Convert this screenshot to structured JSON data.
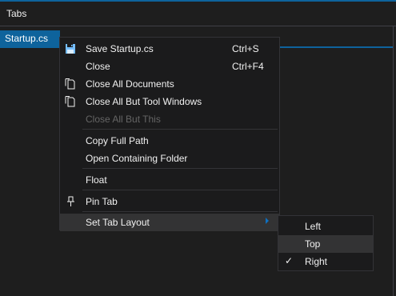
{
  "panel": {
    "title": "Tabs"
  },
  "tab": {
    "label": "Startup.cs"
  },
  "context_menu": {
    "items": [
      {
        "label": "Save Startup.cs",
        "shortcut": "Ctrl+S",
        "icon": "save-icon"
      },
      {
        "label": "Close",
        "shortcut": "Ctrl+F4"
      },
      {
        "label": "Close All Documents",
        "icon": "close-all-documents-icon"
      },
      {
        "label": "Close All But Tool Windows",
        "icon": "close-all-but-tool-windows-icon"
      },
      {
        "label": "Close All But This",
        "disabled": true
      },
      {
        "label": "Copy Full Path"
      },
      {
        "label": "Open Containing Folder"
      },
      {
        "label": "Float"
      },
      {
        "label": "Pin Tab",
        "icon": "pin-icon"
      },
      {
        "label": "Set Tab Layout",
        "submenu": true,
        "highlighted": true
      }
    ]
  },
  "tab_layout_submenu": {
    "items": [
      {
        "label": "Left",
        "checked": false
      },
      {
        "label": "Top",
        "checked": false,
        "highlighted": true
      },
      {
        "label": "Right",
        "checked": true
      }
    ],
    "check_glyph": "✓"
  },
  "colors": {
    "accent": "#0e639c",
    "menu_background": "#1b1b1c",
    "highlight": "#333334",
    "disabled_text": "#656565"
  }
}
